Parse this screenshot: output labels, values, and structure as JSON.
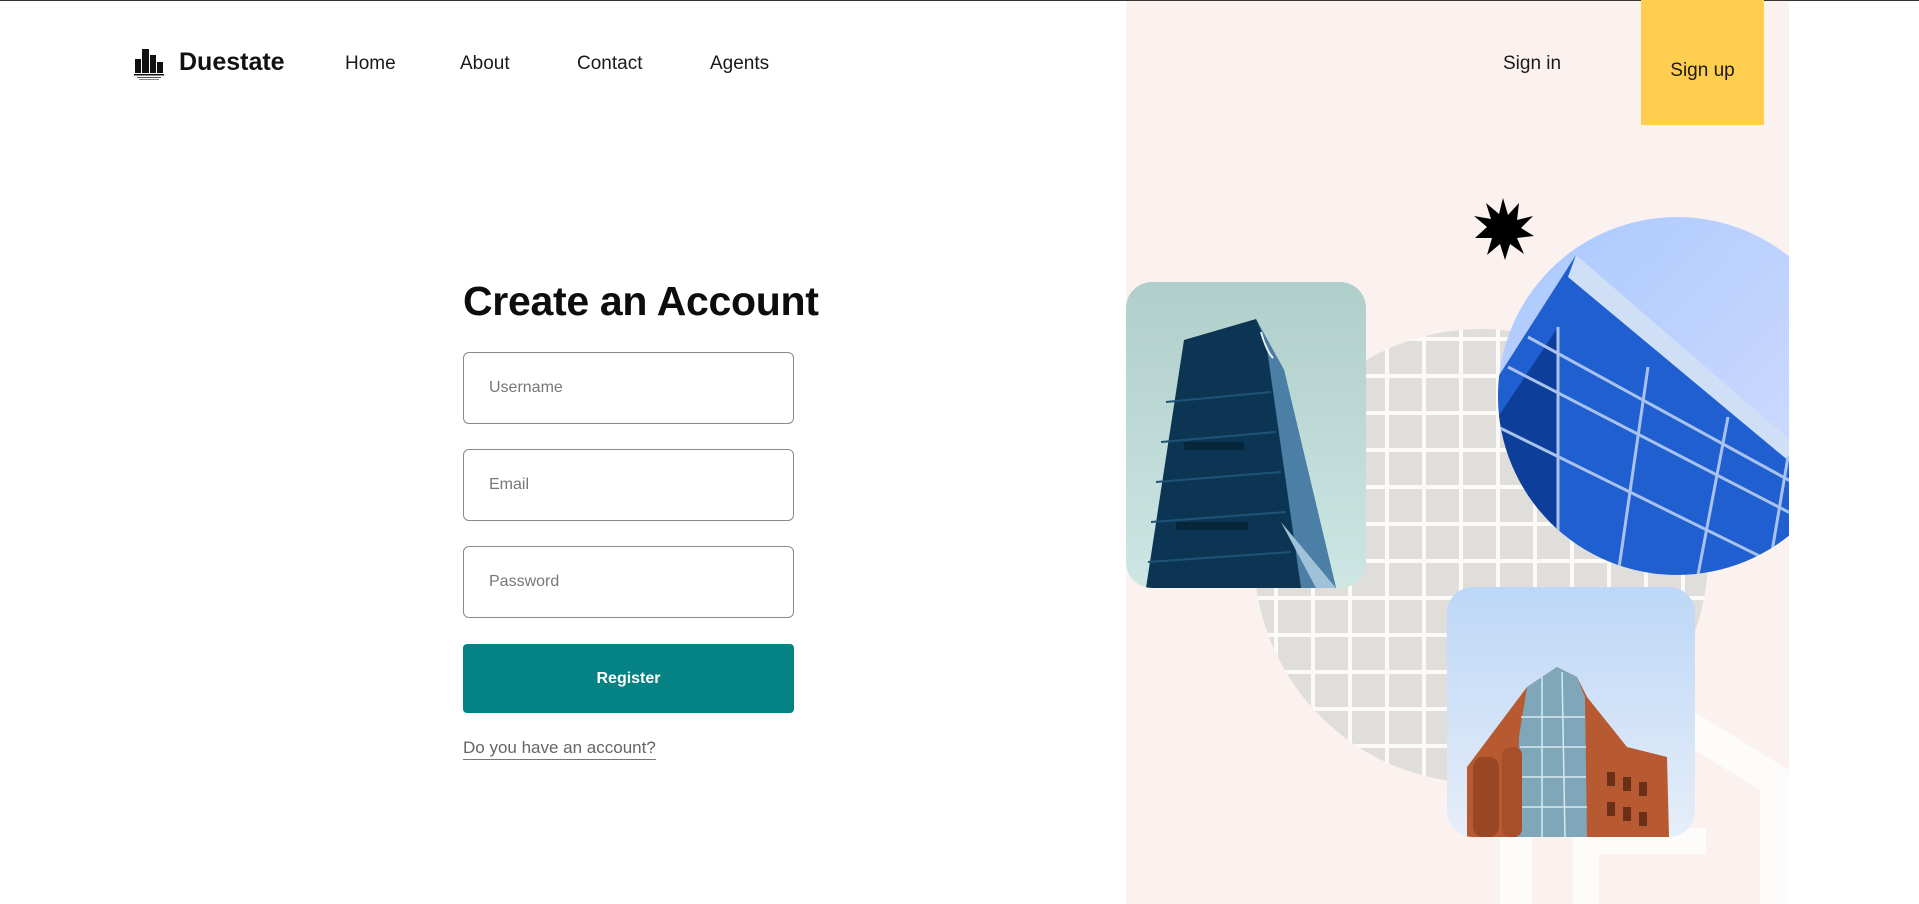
{
  "header": {
    "brand": "Duestate",
    "nav": [
      "Home",
      "About",
      "Contact",
      "Agents"
    ],
    "sign_in": "Sign in",
    "sign_up": "Sign up"
  },
  "form": {
    "title": "Create an Account",
    "fields": {
      "username": {
        "placeholder": "Username",
        "value": ""
      },
      "email": {
        "placeholder": "Email",
        "value": ""
      },
      "password": {
        "placeholder": "Password",
        "value": ""
      }
    },
    "submit_label": "Register",
    "account_link": "Do you have an account?"
  },
  "icons": {
    "logo": "building-logo-icon",
    "burst": "starburst-icon"
  },
  "colors": {
    "accent": "#058384",
    "signup_bg": "#ffce4f",
    "panel_bg": "#fbf2f0"
  }
}
